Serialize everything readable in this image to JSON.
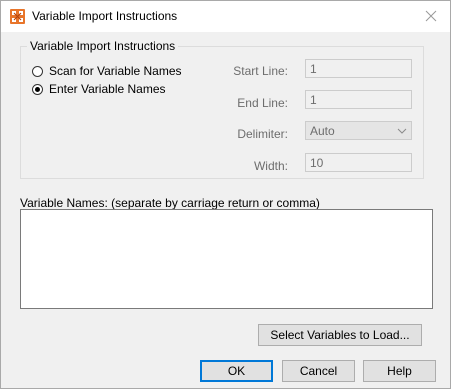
{
  "window": {
    "title": "Variable Import Instructions"
  },
  "group": {
    "title": "Variable Import Instructions",
    "radio_scan": {
      "label": "Scan for Variable Names",
      "checked": false
    },
    "radio_enter": {
      "label": "Enter Variable Names",
      "checked": true
    }
  },
  "fields": {
    "start_line": {
      "label": "Start Line:",
      "value": "1"
    },
    "end_line": {
      "label": "End Line:",
      "value": "1"
    },
    "delimiter": {
      "label": "Delimiter:",
      "value": "Auto"
    },
    "width": {
      "label": "Width:",
      "value": "10"
    }
  },
  "names": {
    "label": "Variable Names: (separate by carriage return or comma)",
    "value": ""
  },
  "buttons": {
    "select_vars": "Select Variables to Load...",
    "ok": "OK",
    "cancel": "Cancel",
    "help": "Help"
  },
  "icons": {
    "app": "app-logo-icon",
    "close": "close-icon",
    "dropdown": "chevron-down-icon"
  },
  "colors": {
    "app_icon": "#e8752a",
    "default_button_border": "#0078d7"
  }
}
